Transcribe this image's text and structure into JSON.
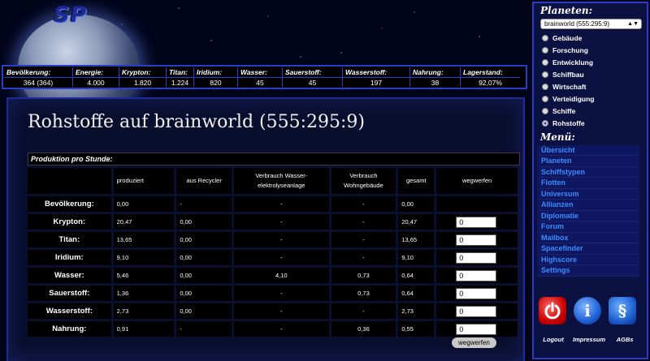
{
  "logo": "SP",
  "resources": [
    {
      "name": "Bevölkerung:",
      "value": "364 (364)",
      "w": 84
    },
    {
      "name": "Energie:",
      "value": "4.000",
      "w": 57
    },
    {
      "name": "Krypton:",
      "value": "1.820",
      "w": 58
    },
    {
      "name": "Titan:",
      "value": "1.224",
      "w": 34
    },
    {
      "name": "Iridium:",
      "value": "820",
      "w": 54
    },
    {
      "name": "Wasser:",
      "value": "45",
      "w": 55
    },
    {
      "name": "Sauerstoff:",
      "value": "45",
      "w": 74
    },
    {
      "name": "Wasserstoff:",
      "value": "197",
      "w": 83
    },
    {
      "name": "Nahrung:",
      "value": "38",
      "w": 62
    },
    {
      "name": "Lagerstand:",
      "value": "92,07%",
      "w": 74
    }
  ],
  "main": {
    "title": "Rohstoffe auf brainworld (555:295:9)",
    "table_title": "Produktion pro Stunde:",
    "columns": [
      "",
      "produziert",
      "aus Recycler",
      "Verbrauch Wasser-elektrolyseanlage",
      "Verbrauch Wohngebäude",
      "gesamt",
      "wegwerfen"
    ],
    "rows": [
      {
        "label": "Bevölkerung:",
        "cells": [
          "0,00",
          "-",
          "-",
          "-",
          "0,00"
        ],
        "input": null
      },
      {
        "label": "Krypton:",
        "cells": [
          "20,47",
          "0,00",
          "-",
          "-",
          "20,47"
        ],
        "input": "0"
      },
      {
        "label": "Titan:",
        "cells": [
          "13,65",
          "0,00",
          "-",
          "-",
          "13,65"
        ],
        "input": "0"
      },
      {
        "label": "Iridium:",
        "cells": [
          "9,10",
          "0,00",
          "-",
          "-",
          "9,10"
        ],
        "input": "0"
      },
      {
        "label": "Wasser:",
        "cells": [
          "5,46",
          "0,00",
          "4,10",
          "0,73",
          "0,64"
        ],
        "input": "0"
      },
      {
        "label": "Sauerstoff:",
        "cells": [
          "1,36",
          "0,00",
          "-",
          "0,73",
          "0,64"
        ],
        "input": "0"
      },
      {
        "label": "Wasserstoff:",
        "cells": [
          "2,73",
          "0,00",
          "-",
          "-",
          "2,73"
        ],
        "input": "0"
      },
      {
        "label": "Nahrung:",
        "cells": [
          "0,91",
          "-",
          "-",
          "0,36",
          "0,55"
        ],
        "input": "0"
      }
    ],
    "button": "wegwerfen"
  },
  "sidebar": {
    "planets_title": "Planeten:",
    "planet_select": "brainworld (555:295:9)",
    "views": [
      {
        "label": "Gebäude",
        "selected": false
      },
      {
        "label": "Forschung",
        "selected": false
      },
      {
        "label": "Entwicklung",
        "selected": false
      },
      {
        "label": "Schiffbau",
        "selected": false
      },
      {
        "label": "Wirtschaft",
        "selected": false
      },
      {
        "label": "Verteidigung",
        "selected": false
      },
      {
        "label": "Schiffe",
        "selected": false
      },
      {
        "label": "Rohstoffe",
        "selected": true
      }
    ],
    "menu_title": "Menü:",
    "menu": [
      "Übersicht",
      "Planeten",
      "Schiffstypen",
      "Flotten",
      "Universum",
      "Allianzen",
      "Diplomatie",
      "Forum",
      "Mailbox",
      "Spacefinder",
      "Highscore",
      "Settings"
    ],
    "icons": [
      {
        "icon": "power-icon",
        "label": "Logout"
      },
      {
        "icon": "info-icon",
        "label": "Impressum"
      },
      {
        "icon": "paragraph-icon",
        "label": "AGBs"
      }
    ]
  }
}
